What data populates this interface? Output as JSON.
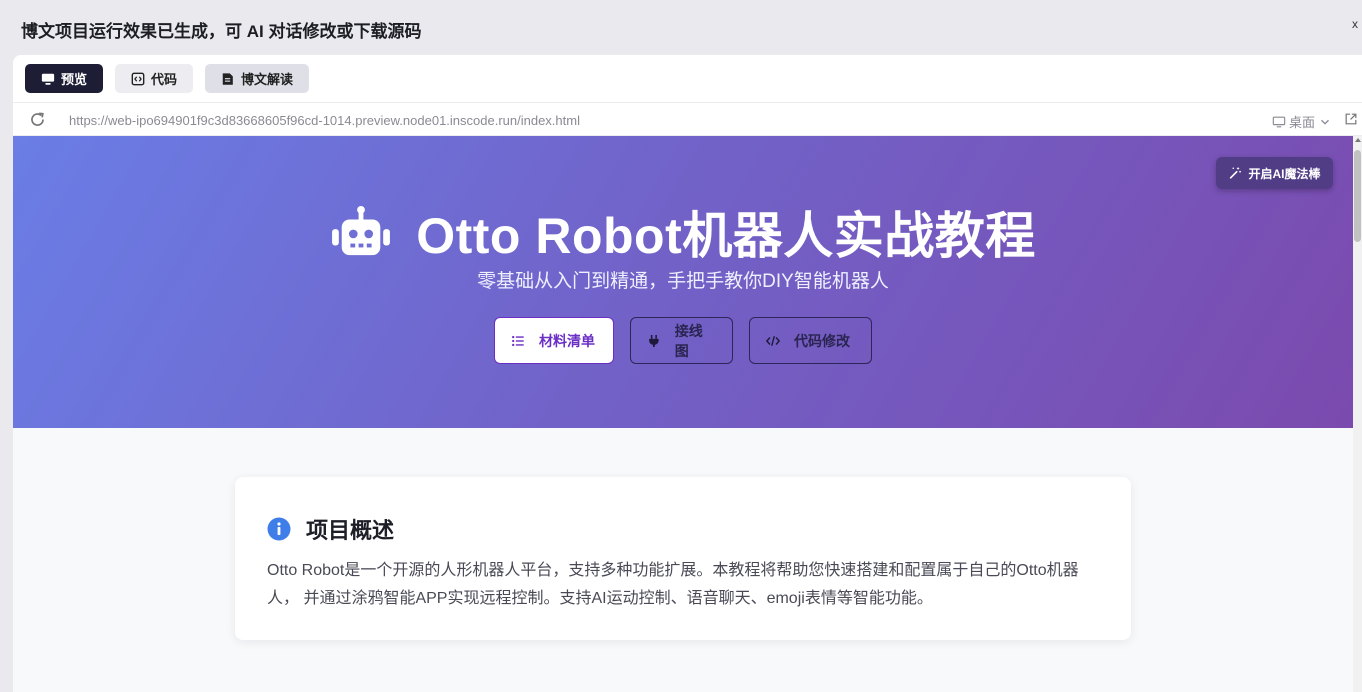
{
  "topbar": {
    "title": "博文项目运行效果已生成，可 AI 对话修改或下载源码",
    "close": "x"
  },
  "tabs": [
    {
      "label": "预览",
      "icon": "monitor-icon",
      "active": true
    },
    {
      "label": "代码",
      "icon": "code-file-icon",
      "active": false
    },
    {
      "label": "博文解读",
      "icon": "document-icon",
      "active": false
    }
  ],
  "urlbar": {
    "url": "https://web-ipo694901f9c3d83668605f96cd-1014.preview.node01.inscode.run/index.html",
    "device": "桌面"
  },
  "hero": {
    "magic_button": "开启AI魔法棒",
    "title": "Otto Robot机器人实战教程",
    "subtitle": "零基础从入门到精通，手把手教你DIY智能机器人",
    "buttons": {
      "materials": "材料清单",
      "wiring": "接线图",
      "code": "代码修改"
    }
  },
  "overview": {
    "title": "项目概述",
    "body": "Otto Robot是一个开源的人形机器人平台，支持多种功能扩展。本教程将帮助您快速搭建和配置属于自己的Otto机器人， 并通过涂鸦智能APP实现远程控制。支持AI运动控制、语音聊天、emoji表情等智能功能。"
  },
  "colors": {
    "hero_start": "#6a7ee6",
    "hero_end": "#7b4aae",
    "primary_purple": "#6b2fc6",
    "tab_active": "#1d1e36",
    "info_blue": "#3f7ee8"
  }
}
